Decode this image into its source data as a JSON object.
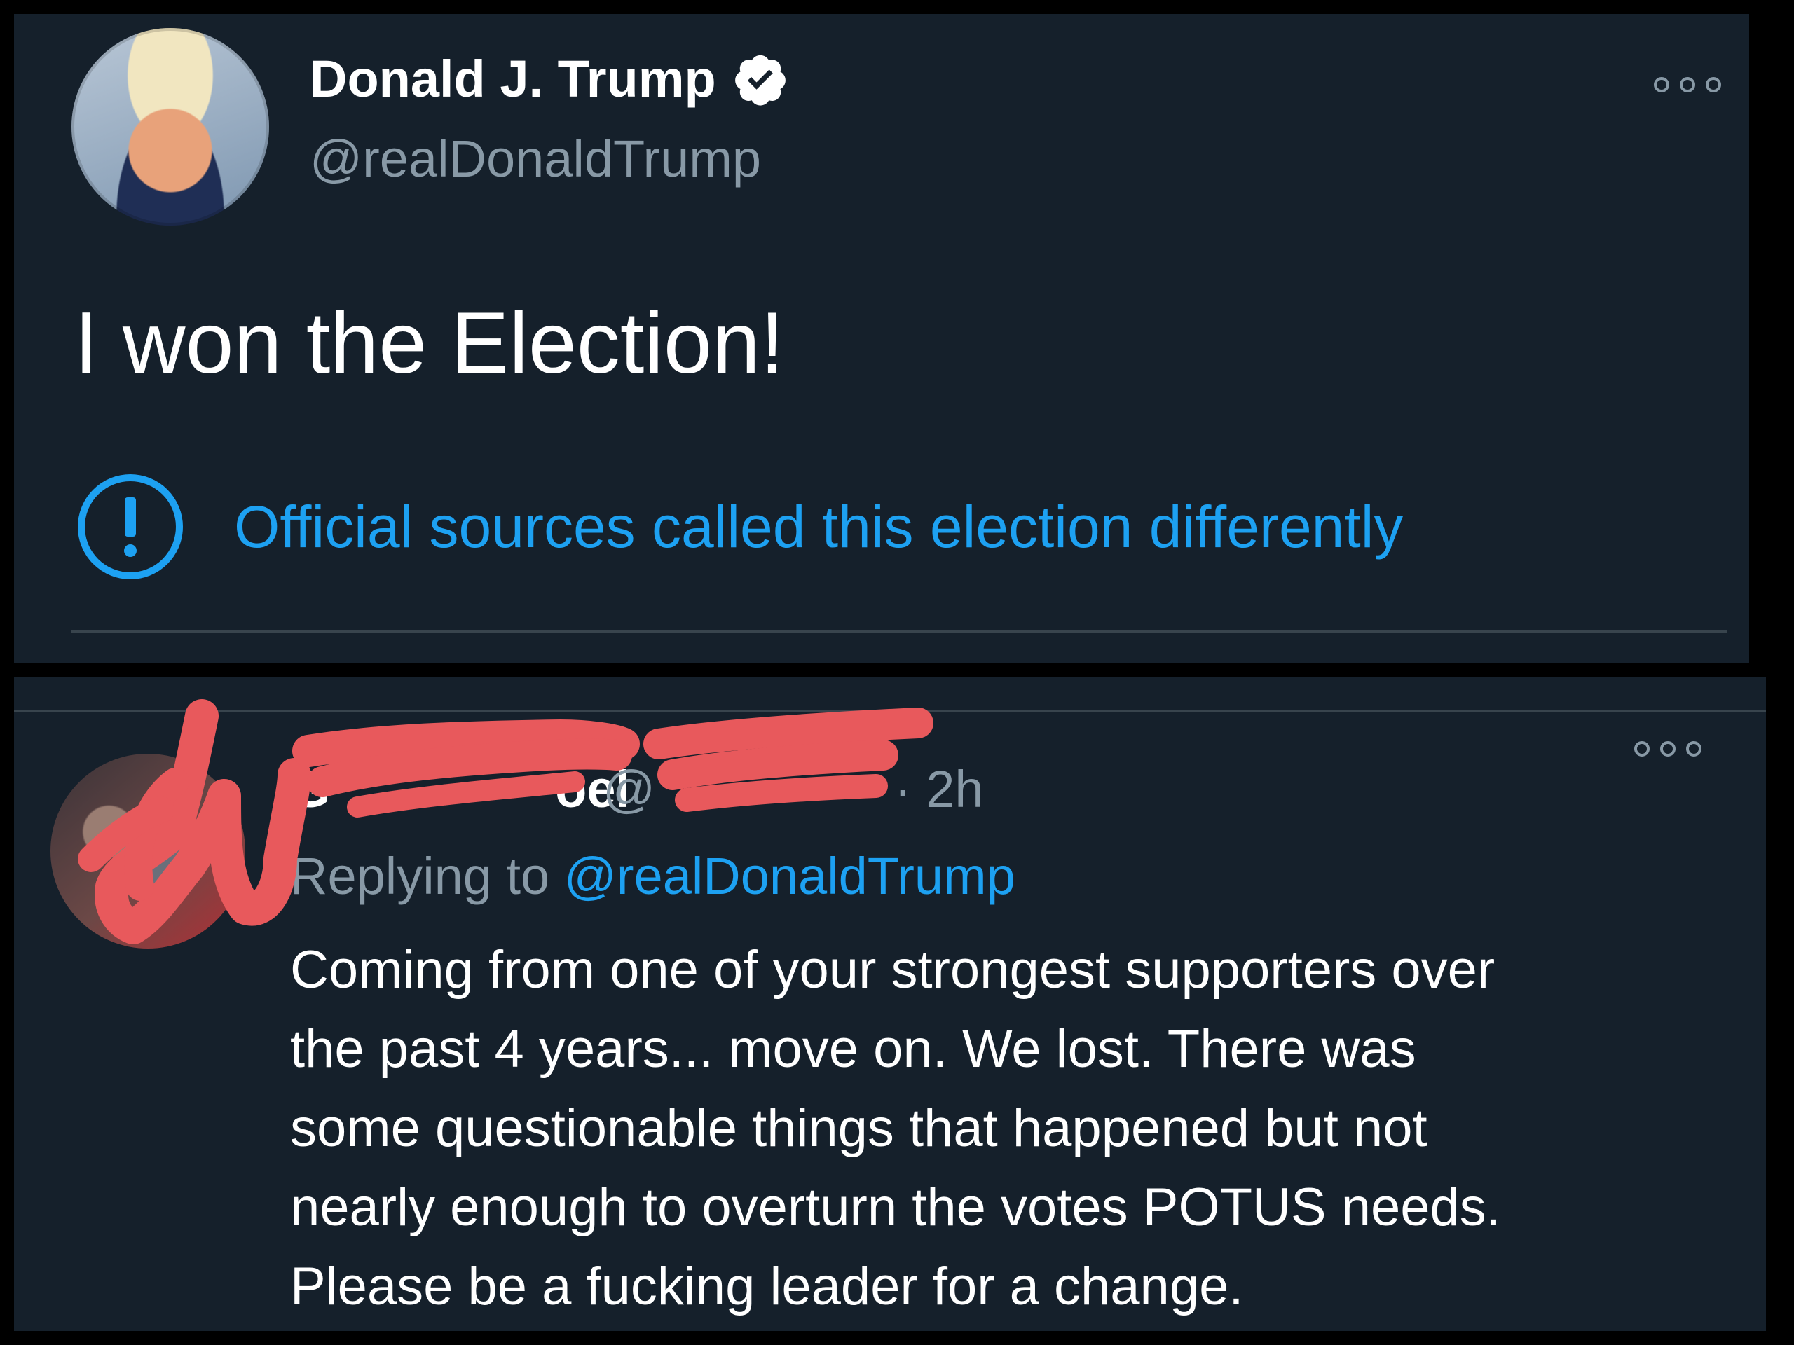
{
  "tweet": {
    "display_name": "Donald J. Trump",
    "handle": "@realDonaldTrump",
    "text": "I won the Election!",
    "notice": "Official sources called this election differently"
  },
  "reply": {
    "name_visible": "G",
    "name_tail_visible": "oel",
    "at_prefix": "@",
    "time": "· 2h",
    "replying_prefix": "Replying to",
    "replying_mention": "@realDonaldTrump",
    "lines": [
      "Coming from one of your strongest supporters over",
      "the past 4 years... move on. We lost. There was",
      "some questionable things that happened but not",
      "nearly enough to overturn the votes POTUS needs.",
      "Please be a fucking leader for a change."
    ]
  },
  "icons": {
    "verified": "verified-badge-icon",
    "notice": "exclamation-circle-icon",
    "more": "more-options-icon"
  },
  "colors": {
    "background": "#15202b",
    "accent": "#1da1f2",
    "secondary_text": "#8899a6",
    "redaction": "#e8595c"
  }
}
